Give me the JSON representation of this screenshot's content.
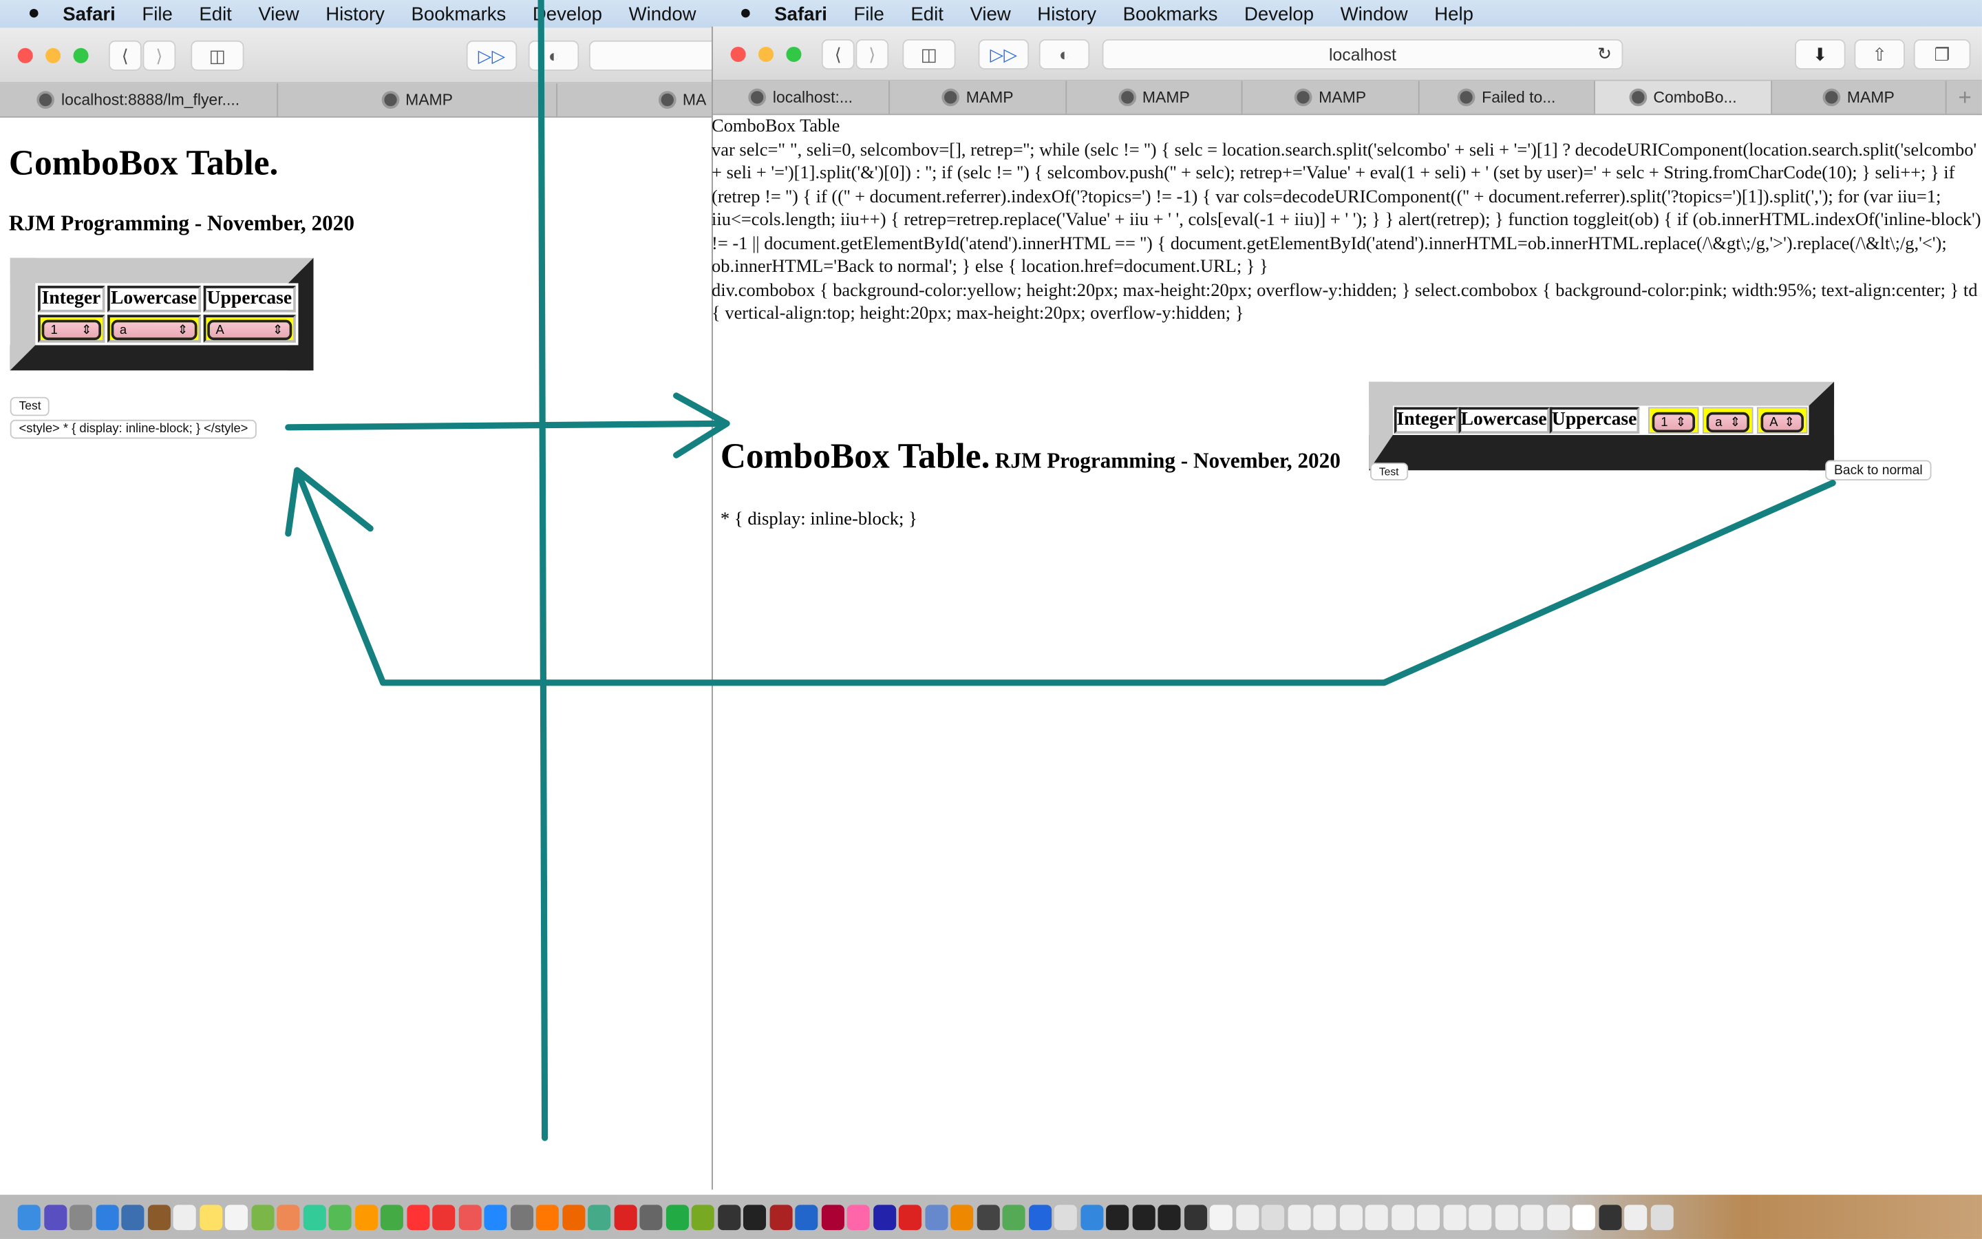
{
  "menubar": {
    "apple": "",
    "app": "Safari",
    "items": [
      "File",
      "Edit",
      "View",
      "History",
      "Bookmarks",
      "Develop",
      "Window",
      "Help"
    ]
  },
  "left_window": {
    "tabs": [
      "localhost:8888/lm_flyer....",
      "MAMP",
      "MA"
    ],
    "heading": "ComboBox Table.",
    "subheading": "RJM Programming - November, 2020",
    "table": {
      "headers": [
        "Integer",
        "Lowercase",
        "Uppercase"
      ],
      "values": [
        "1",
        "a",
        "A"
      ]
    },
    "test_button": "Test",
    "style_button": "<style> * { display: inline-block; } </style>"
  },
  "right_window": {
    "address": "localhost",
    "tabs": [
      "localhost:...",
      "MAMP",
      "MAMP",
      "MAMP",
      "Failed to...",
      "ComboBo...",
      "MAMP"
    ],
    "active_tab": 5,
    "new_tab": "+",
    "code_lines": [
      "ComboBox Table",
      "var selc=\" \", seli=0, selcombov=[], retrep=''; while (selc != '') { selc = location.search.split('selcombo' + seli + '=')[1] ? decodeURIComponent(location.search.split('selcombo' + seli + '=')[1].split('&')[0]) : ''; if (selc != '') { selcombov.push('' + selc); retrep+='Value' + eval(1 + seli) + ' (set by user)=' + selc + String.fromCharCode(10); } seli++; } if (retrep != '') { if (('' + document.referrer).indexOf('?topics=') != -1) { var cols=decodeURIComponent(('' + document.referrer).split('?topics=')[1]).split(','); for (var iiu=1; iiu<=cols.length; iiu++) { retrep=retrep.replace('Value' + iiu + ' ', cols[eval(-1 + iiu)] + ' '); } } alert(retrep); } function toggleit(ob) { if (ob.innerHTML.indexOf('inline-block') != -1 || document.getElementById('atend').innerHTML == '') { document.getElementById('atend').innerHTML=ob.innerHTML.replace(/\\&gt\\;/g,'>').replace(/\\&lt\\;/g,'<'); ob.innerHTML='Back to normal'; } else { location.href=document.URL; } }",
      "div.combobox { background-color:yellow; height:20px; max-height:20px; overflow-y:hidden; } select.combobox { background-color:pink; width:95%; text-align:center; } td { vertical-align:top; height:20px; max-height:20px; overflow-y:hidden; }"
    ],
    "heading": "ComboBox Table.",
    "subheading": "RJM Programming - November, 2020",
    "table": {
      "headers": [
        "Integer",
        "Lowercase",
        "Uppercase"
      ],
      "values": [
        "1",
        "a",
        "A"
      ]
    },
    "test_button": "Test",
    "back_button": "Back to normal",
    "atend_text": "* { display: inline-block; }"
  },
  "colors": {
    "annotation": "#148080",
    "combo_cell": "#ffff00",
    "select": "#f0b4c0"
  }
}
